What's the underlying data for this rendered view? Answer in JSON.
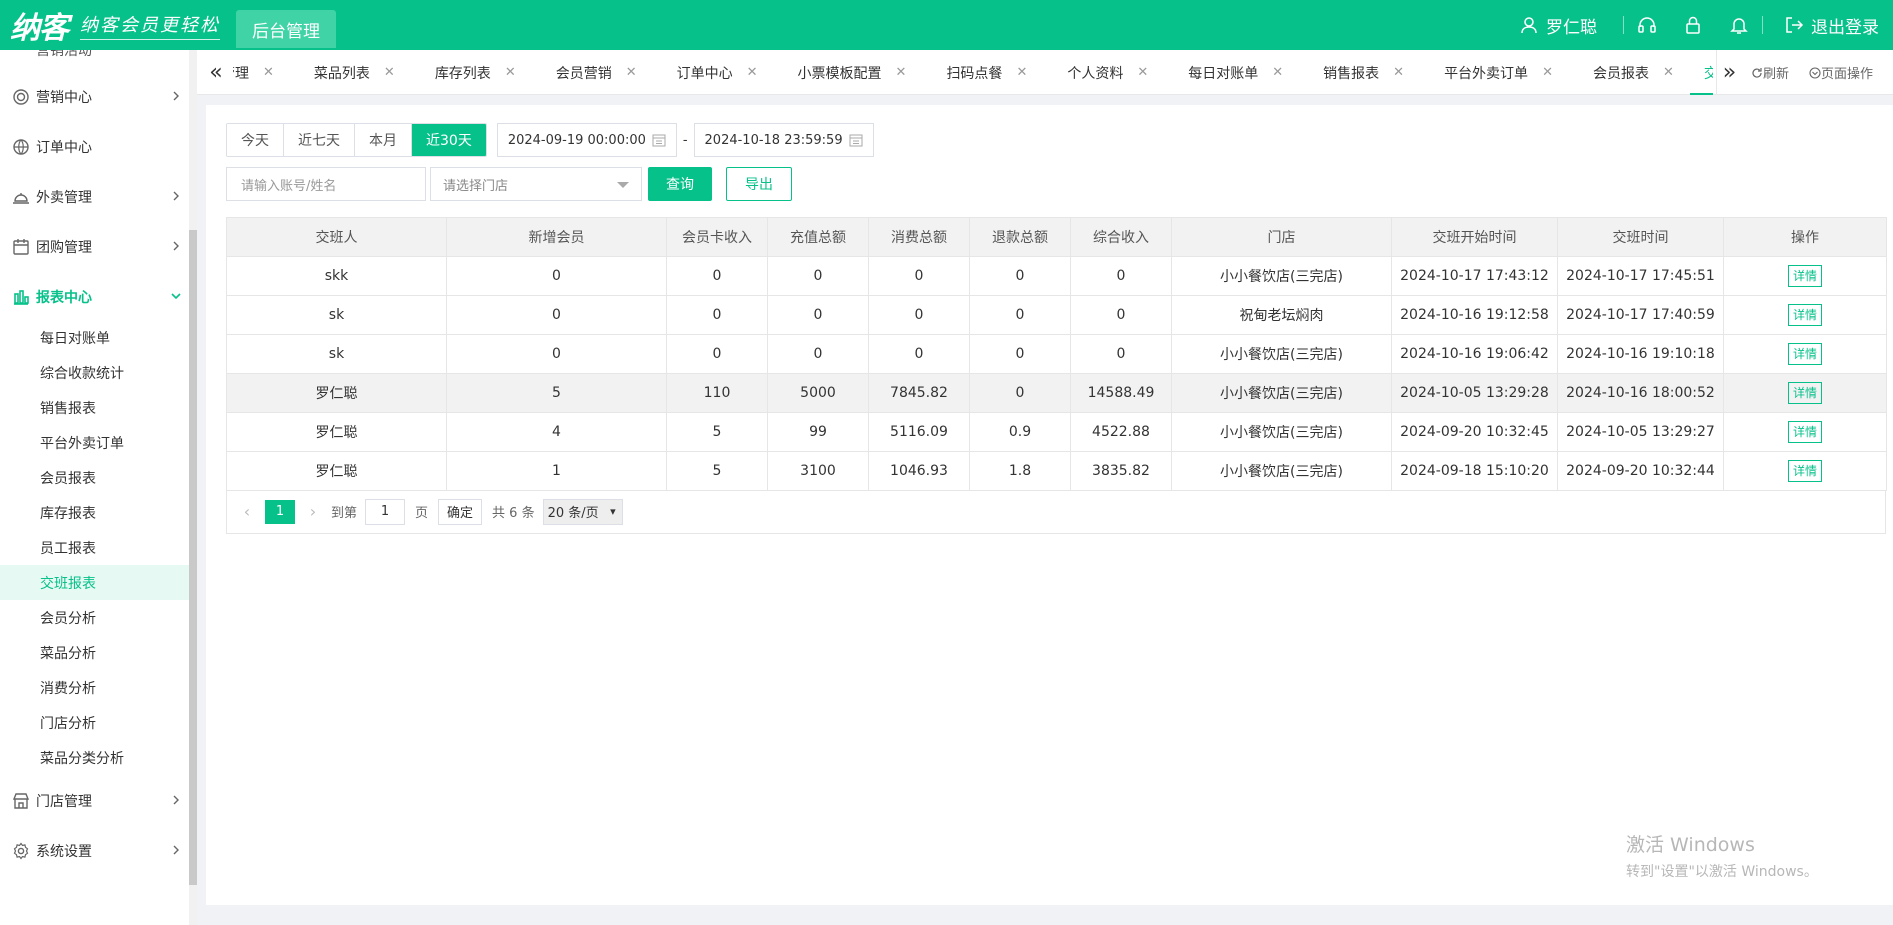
{
  "header": {
    "logo": "纳客",
    "slogan": "纳客会员更轻松",
    "admin_tab": "后台管理",
    "user_name": "罗仁聪",
    "logout": "退出登录"
  },
  "sidebar": {
    "top_cut": "营销活动",
    "items": [
      {
        "label": "营销中心",
        "icon": "target-icon"
      },
      {
        "label": "订单中心",
        "icon": "globe-icon"
      },
      {
        "label": "外卖管理",
        "icon": "bell-dome-icon"
      },
      {
        "label": "团购管理",
        "icon": "calendar-icon"
      },
      {
        "label": "报表中心",
        "icon": "bar-chart-icon"
      },
      {
        "label": "门店管理",
        "icon": "store-icon"
      },
      {
        "label": "系统设置",
        "icon": "gear-icon"
      }
    ],
    "report_sub": [
      "每日对账单",
      "综合收款统计",
      "销售报表",
      "平台外卖订单",
      "会员报表",
      "库存报表",
      "员工报表",
      "交班报表",
      "会员分析",
      "菜品分析",
      "消费分析",
      "门店分析",
      "菜品分类分析"
    ]
  },
  "tabs": [
    "管理",
    "菜品列表",
    "库存列表",
    "会员营销",
    "订单中心",
    "小票模板配置",
    "扫码点餐",
    "个人资料",
    "每日对账单",
    "销售报表",
    "平台外卖订单",
    "会员报表",
    "交班报表"
  ],
  "tab_actions": {
    "refresh": "刷新",
    "page_ops": "页面操作"
  },
  "filters": {
    "ranges": [
      "今天",
      "近七天",
      "本月",
      "近30天"
    ],
    "active_range": "近30天",
    "start": "2024-09-19 00:00:00",
    "end": "2024-10-18 23:59:59",
    "dash": "-",
    "account_placeholder": "请输入账号/姓名",
    "store_placeholder": "请选择门店",
    "query": "查询",
    "export": "导出"
  },
  "table": {
    "headers": [
      "交班人",
      "新增会员",
      "会员卡收入",
      "充值总额",
      "消费总额",
      "退款总额",
      "综合收入",
      "门店",
      "交班开始时间",
      "交班时间",
      "操作"
    ],
    "rows": [
      [
        "skk",
        "0",
        "0",
        "0",
        "0",
        "0",
        "0",
        "小小餐饮店(三完店)",
        "2024-10-17 17:43:12",
        "2024-10-17 17:45:51",
        "详情"
      ],
      [
        "sk",
        "0",
        "0",
        "0",
        "0",
        "0",
        "0",
        "祝甸老坛焖肉",
        "2024-10-16 19:12:58",
        "2024-10-17 17:40:59",
        "详情"
      ],
      [
        "sk",
        "0",
        "0",
        "0",
        "0",
        "0",
        "0",
        "小小餐饮店(三完店)",
        "2024-10-16 19:06:42",
        "2024-10-16 19:10:18",
        "详情"
      ],
      [
        "罗仁聪",
        "5",
        "110",
        "5000",
        "7845.82",
        "0",
        "14588.49",
        "小小餐饮店(三完店)",
        "2024-10-05 13:29:28",
        "2024-10-16 18:00:52",
        "详情"
      ],
      [
        "罗仁聪",
        "4",
        "5",
        "99",
        "5116.09",
        "0.9",
        "4522.88",
        "小小餐饮店(三完店)",
        "2024-09-20 10:32:45",
        "2024-10-05 13:29:27",
        "详情"
      ],
      [
        "罗仁聪",
        "1",
        "5",
        "3100",
        "1046.93",
        "1.8",
        "3835.82",
        "小小餐饮店(三完店)",
        "2024-09-18 15:10:20",
        "2024-09-20 10:32:44",
        "详情"
      ]
    ]
  },
  "pager": {
    "current": "1",
    "goto_label": "到第",
    "goto_value": "1",
    "page_unit": "页",
    "confirm": "确定",
    "total": "共 6 条",
    "page_size": "20 条/页"
  },
  "watermark": {
    "line1": "激活 Windows",
    "line2": "转到\"设置\"以激活 Windows。"
  },
  "colors": {
    "accent": "#07c18a"
  }
}
